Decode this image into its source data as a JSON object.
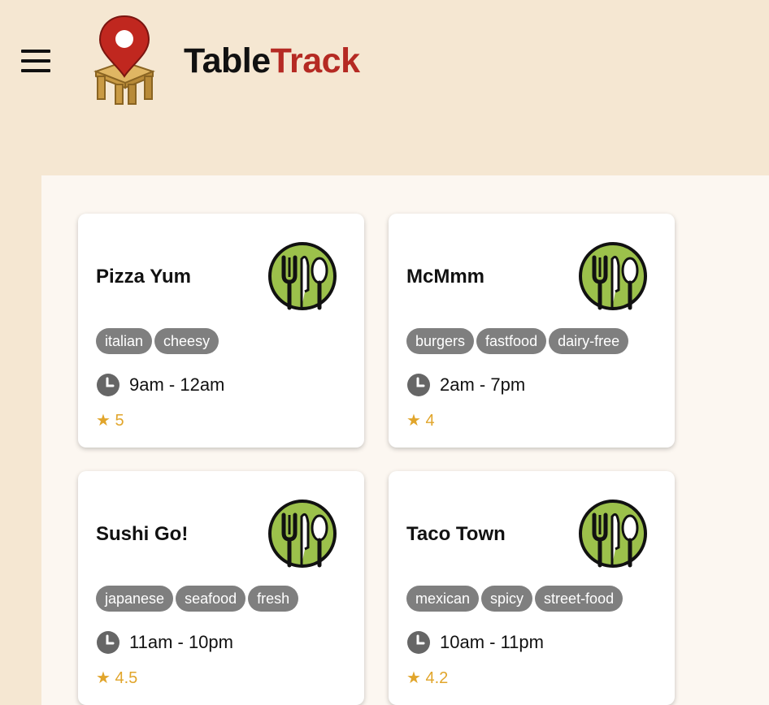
{
  "header": {
    "brand_part1": "Table",
    "brand_part2": "Track",
    "menu_icon": "hamburger-menu-icon",
    "logo_icon": "map-pin-table-icon"
  },
  "colors": {
    "background": "#f5e7d2",
    "content_bg": "#fcf7f1",
    "brand_accent": "#b52a23",
    "tag_bg": "#7f7f7f",
    "star": "#e1a52b",
    "plate_green": "#9cc14b"
  },
  "restaurants": [
    {
      "name": "Pizza Yum",
      "tags": [
        "italian",
        "cheesy"
      ],
      "hours": "9am - 12am",
      "rating": "★ 5"
    },
    {
      "name": "McMmm",
      "tags": [
        "burgers",
        "fastfood",
        "dairy-free"
      ],
      "hours": "2am - 7pm",
      "rating": "★ 4"
    },
    {
      "name": "Sushi Go!",
      "tags": [
        "japanese",
        "seafood",
        "fresh"
      ],
      "hours": "11am - 10pm",
      "rating": "★ 4.5"
    },
    {
      "name": "Taco Town",
      "tags": [
        "mexican",
        "spicy",
        "street-food"
      ],
      "hours": "10am - 11pm",
      "rating": "★ 4.2"
    }
  ]
}
